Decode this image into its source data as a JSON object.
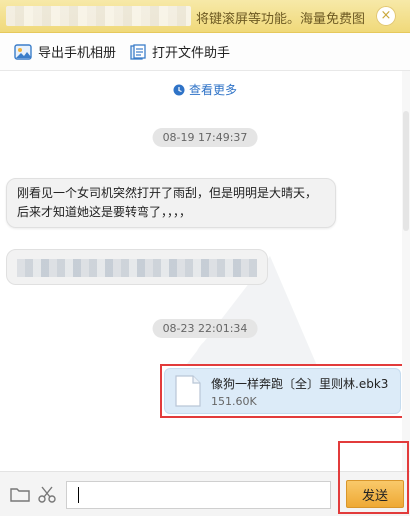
{
  "banner": {
    "text": "将键滚屏等功能。海量免费图",
    "close_symbol": "×"
  },
  "toolbar": {
    "export_photos": "导出手机相册",
    "file_helper": "打开文件助手"
  },
  "chat": {
    "view_more": "查看更多",
    "time_1": "08-19 17:49:37",
    "time_2": "08-23 22:01:34",
    "message_1": "刚看见一个女司机突然打开了雨刮，但是明明是大晴天，后来才知道她这是要转弯了，，，，",
    "file": {
      "name": "像狗一样奔跑〔全〕里则林.ebk3",
      "size": "151.60K"
    }
  },
  "bottom": {
    "input_value": "",
    "send_label": "发送"
  },
  "colors": {
    "accent_red": "#e23b3b",
    "send_orange": "#eea935",
    "link_blue": "#2f73c7"
  }
}
